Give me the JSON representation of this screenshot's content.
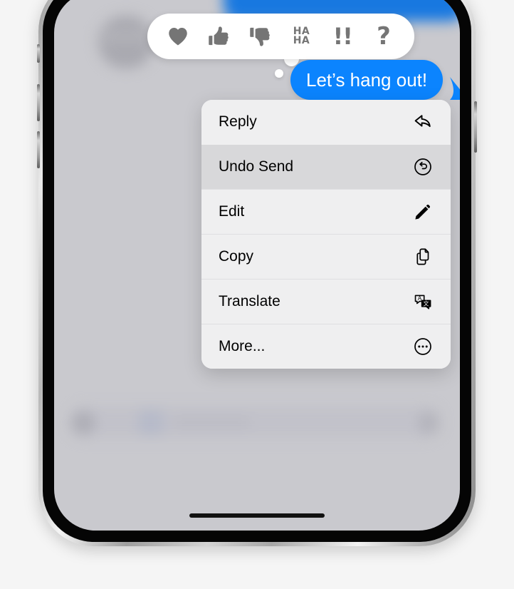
{
  "screen": {
    "background_color": "#C9C9CE",
    "accent_blue": "#0B84FE",
    "menu_background": "#EFEFF0",
    "menu_highlight": "#D8D8DA"
  },
  "message": {
    "text": "Let’s hang out!",
    "bubble_color": "#0B84FE",
    "text_color": "#FFFFFF",
    "alignment": "outgoing-right"
  },
  "tapback": {
    "panel_color": "#FFFFFF",
    "icon_color": "#757575",
    "items": [
      {
        "name": "heart-reaction",
        "label": "Heart",
        "icon": "heart-icon",
        "glyph": ""
      },
      {
        "name": "thumbsup-reaction",
        "label": "Thumbs Up",
        "icon": "thumbs-up-icon",
        "glyph": ""
      },
      {
        "name": "thumbsdown-reaction",
        "label": "Thumbs Down",
        "icon": "thumbs-down-icon",
        "glyph": ""
      },
      {
        "name": "haha-reaction",
        "label": "Haha",
        "icon": "haha-icon",
        "glyph": "HA\nHA"
      },
      {
        "name": "exclamation-reaction",
        "label": "Exclamation",
        "icon": "double-exclamation-icon",
        "glyph": "!!"
      },
      {
        "name": "question-reaction",
        "label": "Question",
        "icon": "question-mark-icon",
        "glyph": "?"
      }
    ]
  },
  "context_menu": {
    "items": [
      {
        "label": "Reply",
        "icon": "reply-arrow-icon",
        "highlighted": false
      },
      {
        "label": "Undo Send",
        "icon": "undo-circle-icon",
        "highlighted": true
      },
      {
        "label": "Edit",
        "icon": "pencil-icon",
        "highlighted": false
      },
      {
        "label": "Copy",
        "icon": "copy-pages-icon",
        "highlighted": false
      },
      {
        "label": "Translate",
        "icon": "translate-icon",
        "highlighted": false
      },
      {
        "label": "More...",
        "icon": "ellipsis-circle-icon",
        "highlighted": false
      }
    ]
  },
  "device": {
    "frame_finish": "titanium-silver",
    "home_indicator": true,
    "buttons": [
      "silence-switch",
      "volume-up",
      "volume-down",
      "side-power"
    ]
  }
}
